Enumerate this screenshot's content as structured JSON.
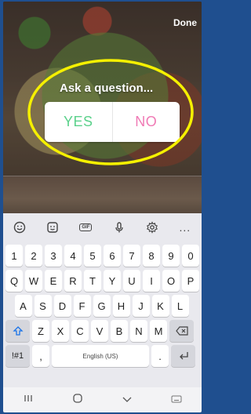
{
  "header": {
    "done_label": "Done"
  },
  "question": {
    "placeholder": "Ask a question..."
  },
  "poll": {
    "yes_label": "YES",
    "no_label": "NO",
    "yes_color": "#5bd18b",
    "no_color": "#f07ab5"
  },
  "annotation": {
    "color": "#f5f000"
  },
  "keyboard": {
    "toolbar": [
      "emoji-icon",
      "sticker-icon",
      "gif-icon",
      "mic-icon",
      "settings-icon",
      "more-icon"
    ],
    "gif_label": "GIF",
    "more_label": "...",
    "number_row": [
      "1",
      "2",
      "3",
      "4",
      "5",
      "6",
      "7",
      "8",
      "9",
      "0"
    ],
    "row1": [
      "Q",
      "W",
      "E",
      "R",
      "T",
      "Y",
      "U",
      "I",
      "O",
      "P"
    ],
    "row2": [
      "A",
      "S",
      "D",
      "F",
      "G",
      "H",
      "J",
      "K",
      "L"
    ],
    "row3": [
      "Z",
      "X",
      "C",
      "V",
      "B",
      "N",
      "M"
    ],
    "symbols_label": "!#1",
    "comma_label": ",",
    "space_label": "English (US)",
    "period_label": "."
  },
  "navbar": [
    "recent-apps-icon",
    "home-icon",
    "back-icon",
    "keyboard-icon"
  ]
}
